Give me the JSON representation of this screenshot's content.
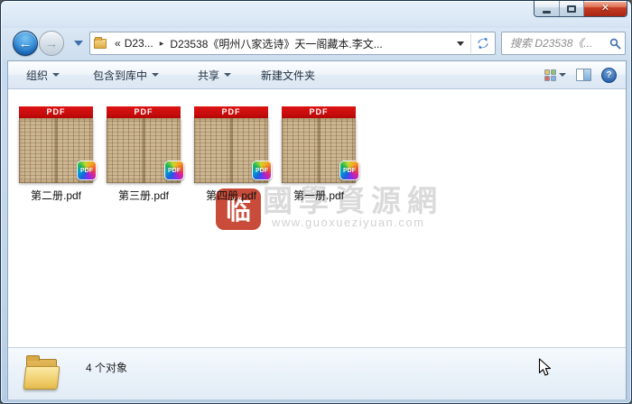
{
  "window": {
    "controls": {
      "close_glyph": "✕"
    }
  },
  "navigation": {
    "back_glyph": "←",
    "forward_glyph": "→",
    "breadcrumb": {
      "overflow_glyph": "«",
      "parent": "D23...",
      "separator_glyph": "▶",
      "current": "D23538《明州八家选诗》天一阁藏本.李文..."
    },
    "search_placeholder": "搜索 D23538《..."
  },
  "toolbar": {
    "organize": "组织",
    "include_in_library": "包含到库中",
    "share": "共享",
    "new_folder": "新建文件夹",
    "help_glyph": "?"
  },
  "files": [
    {
      "name": "第二册.pdf"
    },
    {
      "name": "第三册.pdf"
    },
    {
      "name": "第四册.pdf"
    },
    {
      "name": "第一册.pdf"
    }
  ],
  "pdf_icon": {
    "band_label": "PDF",
    "badge_label": "PDF"
  },
  "watermark": {
    "seal_glyph": "临",
    "site_name": "國學資源網",
    "site_url": "www.guoxueziyuan.com"
  },
  "details_pane": {
    "item_count": "4 个对象"
  },
  "colors": {
    "pdf_band_red": "#c90d0d",
    "page_tan": "#cdb691",
    "seal_red": "#c84c39",
    "watermark_gray": "#dadada",
    "accent_blue": "#2a6fc9"
  }
}
